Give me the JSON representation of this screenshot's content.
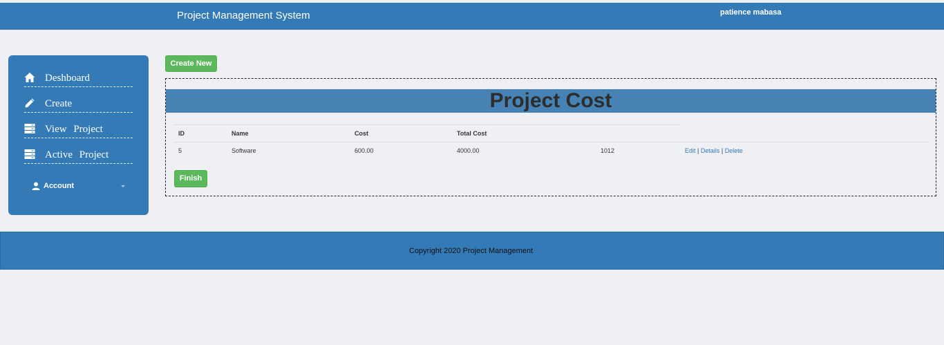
{
  "header": {
    "title": "Project Management System",
    "user": "patience mabasa",
    "bg_color": "#337ab7"
  },
  "sidebar": {
    "items": [
      {
        "label": "Deshboard",
        "icon": "home-icon"
      },
      {
        "label": "Create",
        "icon": "pencil-icon"
      },
      {
        "label": "View Project",
        "icon": "list-icon"
      },
      {
        "label": "Active Project",
        "icon": "list-icon"
      }
    ],
    "account": {
      "label": "Account",
      "icon": "user-icon"
    }
  },
  "main": {
    "create_new_label": "Create New",
    "banner_title": "Project Cost",
    "table": {
      "headers": [
        "ID",
        "Name",
        "Cost",
        "Total Cost"
      ],
      "rows": [
        {
          "id": "5",
          "name": "Software",
          "cost": "600.00",
          "total_cost": "4000.00",
          "extra": "1012",
          "actions": {
            "edit": "Edit",
            "details": "Details",
            "delete": "Delete",
            "separator": "|"
          }
        }
      ]
    },
    "finish_label": "Finish",
    "accent_green": "#5cb85c"
  },
  "footer": {
    "text": "Copyright 2020 Project Management"
  }
}
